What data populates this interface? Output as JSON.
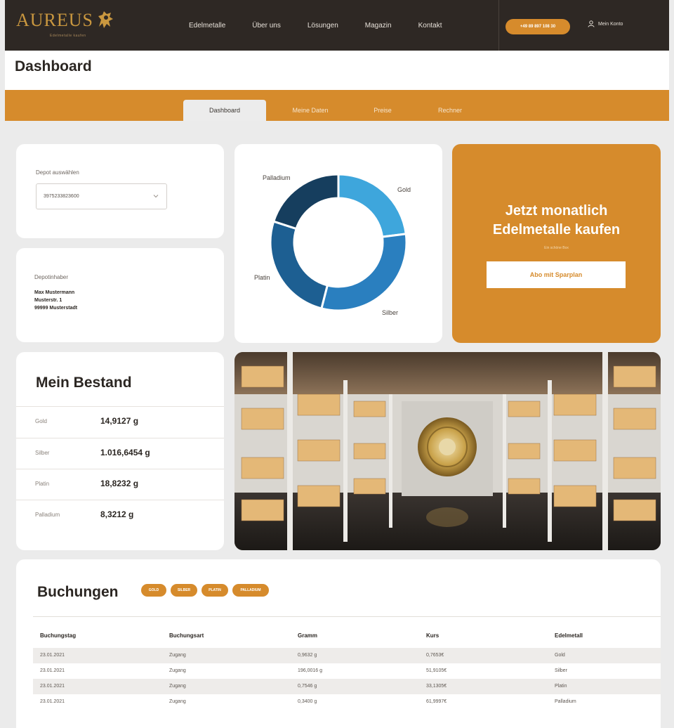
{
  "brand": {
    "name": "AUREUS",
    "tagline": "Edelmetalle kaufen"
  },
  "nav": {
    "items": [
      "Edelmetalle",
      "Über uns",
      "Lösungen",
      "Magazin",
      "Kontakt"
    ],
    "phone": "+49 89 897 108 30",
    "account": "Mein Konto"
  },
  "page": {
    "title": "Dashboard"
  },
  "tabs": [
    "Dashboard",
    "Meine Daten",
    "Preise",
    "Rechner"
  ],
  "depot": {
    "label": "Depot auswählen",
    "selected": "3975233823600"
  },
  "owner": {
    "label": "Depotinhaber",
    "lines": [
      "Max Mustermann",
      "Musterstr. 1",
      "99999 Musterstadt"
    ]
  },
  "chart_data": {
    "type": "pie",
    "categories": [
      "Gold",
      "Silber",
      "Platin",
      "Palladium"
    ],
    "values": [
      23,
      31,
      26,
      20
    ],
    "colors": [
      "#3ea6dc",
      "#2a7fbf",
      "#1d5f92",
      "#163e5e"
    ]
  },
  "promo": {
    "title_line1": "Jetzt monatlich",
    "title_line2": "Edelmetalle kaufen",
    "small": "Ein schöne Box",
    "button": "Abo mit Sparplan"
  },
  "bestand": {
    "title": "Mein Bestand",
    "rows": [
      {
        "metal": "Gold",
        "value": "14,9127 g"
      },
      {
        "metal": "Silber",
        "value": "1.016,6454 g"
      },
      {
        "metal": "Platin",
        "value": "18,8232 g"
      },
      {
        "metal": "Palladium",
        "value": "8,3212 g"
      }
    ]
  },
  "bookings": {
    "title": "Buchungen",
    "filters": [
      "GOLD",
      "SILBER",
      "PLATIN",
      "PALLADIUM"
    ],
    "headers": [
      "Buchungstag",
      "Buchungsart",
      "Gramm",
      "Kurs",
      "Edelmetall"
    ],
    "rows": [
      [
        "23.01.2021",
        "Zugang",
        "0,9632 g",
        "0,7653€",
        "Gold"
      ],
      [
        "23.01.2021",
        "Zugang",
        "196,0016 g",
        "51,9105€",
        "Silber"
      ],
      [
        "23.01.2021",
        "Zugang",
        "0,7546 g",
        "33,1305€",
        "Platin"
      ],
      [
        "23.01.2021",
        "Zugang",
        "0,3400 g",
        "61,9997€",
        "Palladium"
      ]
    ]
  },
  "colors": {
    "accent": "#d68b2c",
    "dark": "#2e2824"
  }
}
